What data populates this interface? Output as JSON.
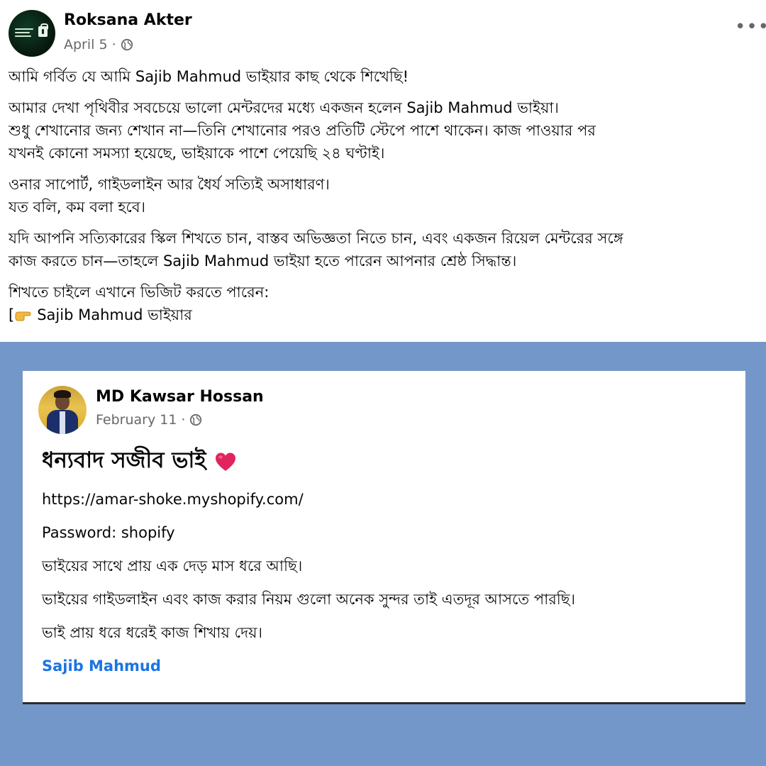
{
  "post": {
    "author": "Roksana Akter",
    "date": "April 5",
    "date_sep": " · ",
    "more": "•••",
    "paragraphs": [
      [
        "আমি গর্বিত যে আমি Sajib Mahmud ভাইয়ার কাছ থেকে শিখেছি!"
      ],
      [
        "আমার দেখা পৃথিবীর সবচেয়ে ভালো মেন্টরদের মধ্যে একজন হলেন Sajib Mahmud ভাইয়া।",
        "শুধু শেখানোর জন্য শেখান না—তিনি শেখানোর পরও প্রতিটি স্টেপে পাশে থাকেন। কাজ পাওয়ার পর",
        "যখনই কোনো সমস্যা হয়েছে, ভাইয়াকে পাশে পেয়েছি ২৪ ঘণ্টাই।"
      ],
      [
        "ওনার সাপোর্ট, গাইডলাইন আর ধৈর্য সত্যিই অসাধারণ।",
        "যত বলি, কম বলা হবে।"
      ],
      [
        "যদি আপনি সত্যিকারের স্কিল শিখতে চান, বাস্তব অভিজ্ঞতা নিতে চান, এবং একজন রিয়েল মেন্টরের সঙ্গে",
        "কাজ করতে চান—তাহলে Sajib Mahmud ভাইয়া হতে পারেন আপনার শ্রেষ্ঠ সিদ্ধান্ত।"
      ],
      [
        "শিখতে চাইলে এখানে ভিজিট করতে পারেন:"
      ]
    ],
    "link_prefix": "[",
    "link_text": "Sajib Mahmud ভাইয়ার"
  },
  "shared": {
    "author": "MD Kawsar Hossan",
    "date": "February 11",
    "date_sep": " · ",
    "headline": "ধন্যবাদ সজীব ভাই",
    "lines": [
      "https://amar-shoke.myshopify.com/",
      "Password: shopify",
      "ভাইয়ের সাথে প্রায় এক দেড় মাস ধরে আছি।",
      "ভাইয়ের গাইডলাইন এবং কাজ করার নিয়ম গুলো অনেক সুন্দর তাই এতদূর আসতে পারছি।",
      "ভাই প্রায় ধরে ধরেই কাজ শিখায় দেয়।"
    ],
    "mention": "Sajib Mahmud"
  },
  "colors": {
    "background_band": "#7497c9",
    "link": "#1b74e4",
    "meta_text": "#65676b",
    "heart": "#e0245e"
  },
  "icons": {
    "privacy": "globe-icon",
    "emoji_heart": "heart-icon",
    "emoji_point": "pointing-right-icon",
    "more": "more-options-icon"
  }
}
